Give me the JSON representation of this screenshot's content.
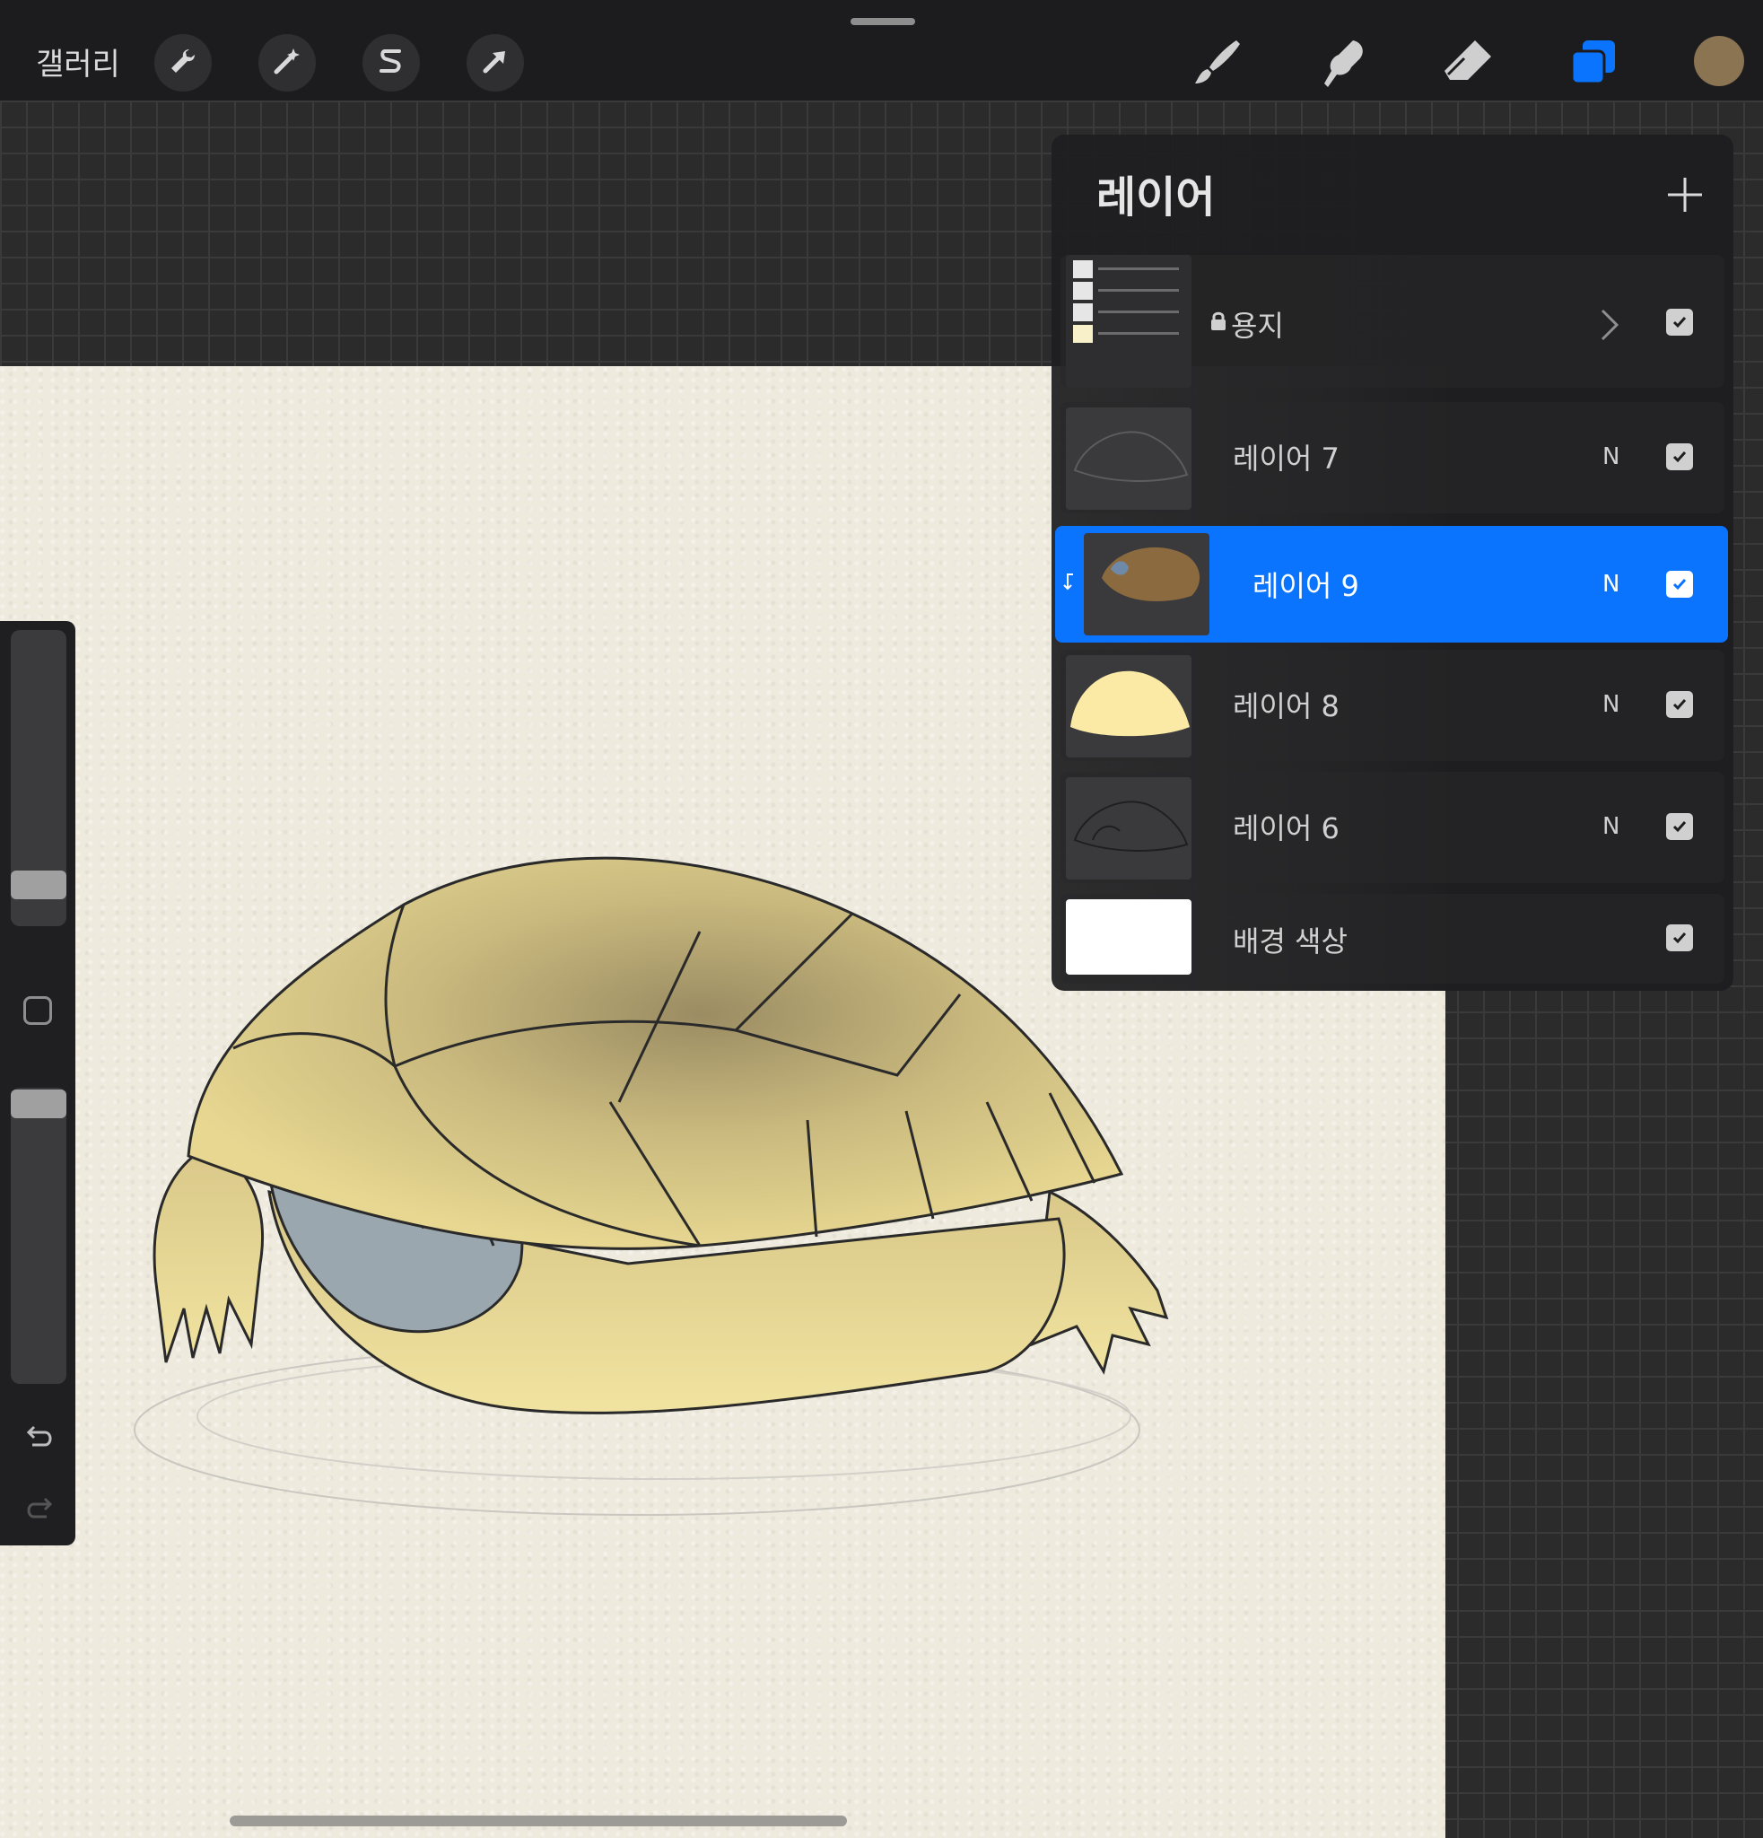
{
  "topbar": {
    "gallery_label": "갤러리",
    "left_tools": [
      "wrench-icon",
      "magic-wand-icon",
      "selection-icon",
      "transform-arrow-icon"
    ],
    "right_tools": [
      "brush-icon",
      "smudge-icon",
      "eraser-icon",
      "layers-icon"
    ],
    "active_tool": "layers-icon",
    "current_color": "#8a7452",
    "accent": "#0a74ff"
  },
  "layers_panel": {
    "title": "레이어",
    "add_label": "+",
    "layers": [
      {
        "name": "용지",
        "locked": true,
        "blend": "",
        "visible": true,
        "type": "group"
      },
      {
        "name": "레이어 7",
        "blend": "N",
        "visible": true
      },
      {
        "name": "레이어 9",
        "blend": "N",
        "visible": true,
        "selected": true,
        "clipped": true
      },
      {
        "name": "레이어 8",
        "blend": "N",
        "visible": true
      },
      {
        "name": "레이어 6",
        "blend": "N",
        "visible": true
      },
      {
        "name": "배경 색상",
        "blend": "",
        "visible": true,
        "type": "background"
      }
    ]
  },
  "sidebar": {
    "brush_size_level": 0.25,
    "opacity_level": 0.95
  }
}
